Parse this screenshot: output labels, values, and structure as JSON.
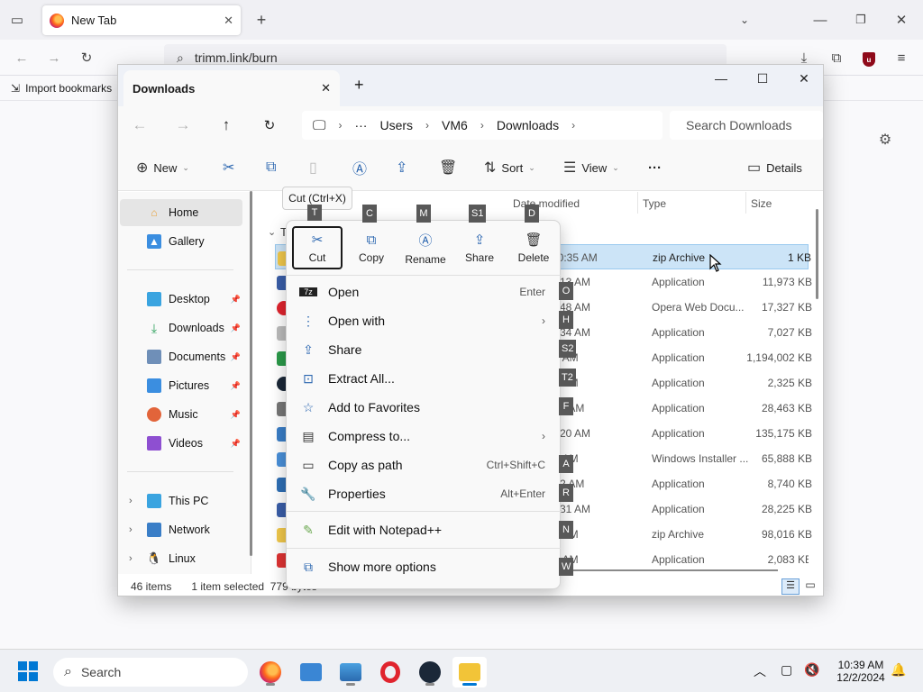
{
  "firefox": {
    "tab_title": "New Tab",
    "url": "trimm.link/burn",
    "bookmark": "Import bookmarks"
  },
  "explorer": {
    "tab_title": "Downloads",
    "breadcrumbs": [
      "Users",
      "VM6",
      "Downloads"
    ],
    "breadcrumb_more": "···",
    "search_placeholder": "Search Downloads",
    "toolbar": {
      "new": "New",
      "sort": "Sort",
      "view": "View",
      "more": "···",
      "details": "Details"
    },
    "tooltip": "Cut (Ctrl+X)",
    "nav": {
      "home": "Home",
      "gallery": "Gallery",
      "desktop": "Desktop",
      "downloads": "Downloads",
      "documents": "Documents",
      "pictures": "Pictures",
      "music": "Music",
      "videos": "Videos",
      "this_pc": "This PC",
      "network": "Network",
      "linux": "Linux"
    },
    "columns": {
      "date": "Date modified",
      "type": "Type",
      "size": "Size"
    },
    "group_label": "T",
    "files": [
      {
        "date": "10:35 AM",
        "type": "zip Archive",
        "size": "1 KB"
      },
      {
        "date": "3:13 AM",
        "type": "Application",
        "size": "11,973 KB"
      },
      {
        "date": "3:48 AM",
        "type": "Opera Web Docu...",
        "size": "17,327 KB"
      },
      {
        "date": "3:34 AM",
        "type": "Application",
        "size": "7,027 KB"
      },
      {
        "date": ":3 AM",
        "type": "Application",
        "size": "1,194,002 KB"
      },
      {
        "date": ":5 AM",
        "type": "Application",
        "size": "2,325 KB"
      },
      {
        "date": ":23 AM",
        "type": "Application",
        "size": "28,463 KB"
      },
      {
        "date": "4:20 AM",
        "type": "Application",
        "size": "135,175 KB"
      },
      {
        "date": ":8 AM",
        "type": "Windows Installer ...",
        "size": "65,888 KB"
      },
      {
        "date": ":52 AM",
        "type": "Application",
        "size": "8,740 KB"
      },
      {
        "date": "3:31 AM",
        "type": "Application",
        "size": "28,225 KB"
      },
      {
        "date": ":0 AM",
        "type": "zip Archive",
        "size": "98,016 KB"
      },
      {
        "date": ":8 AM",
        "type": "Application",
        "size": "2,083 KB"
      }
    ],
    "status": {
      "items": "46 items",
      "selected": "1 item selected",
      "bytes": "779 bytes"
    }
  },
  "context_menu": {
    "quick_actions": [
      {
        "label": "Cut",
        "key": "T"
      },
      {
        "label": "Copy",
        "key": "C"
      },
      {
        "label": "Rename",
        "key": "M"
      },
      {
        "label": "Share",
        "key": "S1"
      },
      {
        "label": "Delete",
        "key": "D"
      }
    ],
    "items": [
      {
        "label": "Open",
        "shortcut": "Enter",
        "key": "O"
      },
      {
        "label": "Open with",
        "key": "H"
      },
      {
        "label": "Share",
        "key": "S2"
      },
      {
        "label": "Extract All...",
        "key": "T2"
      },
      {
        "label": "Add to Favorites",
        "key": "F"
      },
      {
        "label": "Compress to...",
        "key": ""
      },
      {
        "label": "Copy as path",
        "shortcut": "Ctrl+Shift+C",
        "key": "A"
      },
      {
        "label": "Properties",
        "shortcut": "Alt+Enter",
        "key": "R"
      },
      {
        "label": "Edit with Notepad++",
        "key": "N"
      },
      {
        "label": "Show more options",
        "key": "W"
      }
    ]
  },
  "taskbar": {
    "search": "Search",
    "time": "10:39 AM",
    "date": "12/2/2024"
  }
}
